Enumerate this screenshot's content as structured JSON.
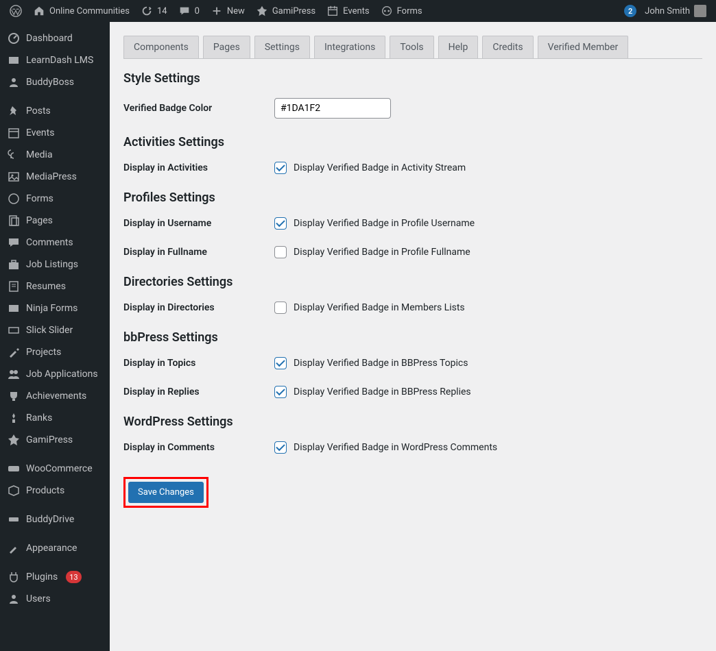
{
  "adminbar": {
    "site_name": "Online Communities",
    "updates_count": "14",
    "comments_count": "0",
    "new_label": "New",
    "gamipress_label": "GamiPress",
    "events_label": "Events",
    "forms_label": "Forms",
    "notif_count": "2",
    "user_name": "John Smith"
  },
  "sidebar": {
    "items": [
      {
        "label": "Dashboard",
        "icon": "dashboard"
      },
      {
        "label": "LearnDash LMS",
        "icon": "learndash"
      },
      {
        "label": "BuddyBoss",
        "icon": "buddyboss"
      },
      {
        "label": "Posts",
        "icon": "pin",
        "sep_before": true
      },
      {
        "label": "Events",
        "icon": "calendar"
      },
      {
        "label": "Media",
        "icon": "media"
      },
      {
        "label": "MediaPress",
        "icon": "mediapress"
      },
      {
        "label": "Forms",
        "icon": "forms"
      },
      {
        "label": "Pages",
        "icon": "pages"
      },
      {
        "label": "Comments",
        "icon": "comments"
      },
      {
        "label": "Job Listings",
        "icon": "briefcase"
      },
      {
        "label": "Resumes",
        "icon": "resume"
      },
      {
        "label": "Ninja Forms",
        "icon": "ninja"
      },
      {
        "label": "Slick Slider",
        "icon": "slider"
      },
      {
        "label": "Projects",
        "icon": "brush"
      },
      {
        "label": "Job Applications",
        "icon": "users"
      },
      {
        "label": "Achievements",
        "icon": "trophy"
      },
      {
        "label": "Ranks",
        "icon": "rank"
      },
      {
        "label": "GamiPress",
        "icon": "gamipress"
      },
      {
        "label": "WooCommerce",
        "icon": "woo",
        "sep_before": true
      },
      {
        "label": "Products",
        "icon": "products"
      },
      {
        "label": "BuddyDrive",
        "icon": "drive",
        "sep_before": true
      },
      {
        "label": "Appearance",
        "icon": "appearance",
        "sep_before": true
      },
      {
        "label": "Plugins",
        "icon": "plugins",
        "count": "13",
        "sep_before": true
      },
      {
        "label": "Users",
        "icon": "user"
      }
    ]
  },
  "tabs": [
    "Components",
    "Pages",
    "Settings",
    "Integrations",
    "Tools",
    "Help",
    "Credits",
    "Verified Member"
  ],
  "sections": {
    "style": {
      "title": "Style Settings",
      "badge_color_label": "Verified Badge Color",
      "badge_color_value": "#1DA1F2"
    },
    "activities": {
      "title": "Activities Settings",
      "display_label": "Display in Activities",
      "display_desc": "Display Verified Badge in Activity Stream",
      "display_checked": true
    },
    "profiles": {
      "title": "Profiles Settings",
      "username_label": "Display in Username",
      "username_desc": "Display Verified Badge in Profile Username",
      "username_checked": true,
      "fullname_label": "Display in Fullname",
      "fullname_desc": "Display Verified Badge in Profile Fullname",
      "fullname_checked": false
    },
    "directories": {
      "title": "Directories Settings",
      "display_label": "Display in Directories",
      "display_desc": "Display Verified Badge in Members Lists",
      "display_checked": false
    },
    "bbpress": {
      "title": "bbPress Settings",
      "topics_label": "Display in Topics",
      "topics_desc": "Display Verified Badge in BBPress Topics",
      "topics_checked": true,
      "replies_label": "Display in Replies",
      "replies_desc": "Display Verified Badge in BBPress Replies",
      "replies_checked": true
    },
    "wordpress": {
      "title": "WordPress Settings",
      "comments_label": "Display in Comments",
      "comments_desc": "Display Verified Badge in WordPress Comments",
      "comments_checked": true
    }
  },
  "save_label": "Save Changes"
}
